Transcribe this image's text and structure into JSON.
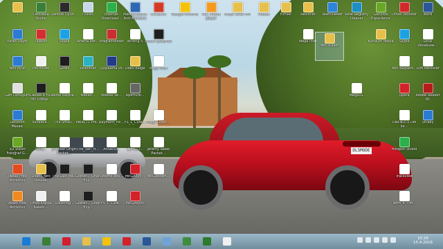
{
  "desktop_icons": [
    {
      "label": "1",
      "icon": "folder-icon",
      "color": "#e7c04b",
      "col": 0,
      "row": 0
    },
    {
      "label": "Camtasia Studio",
      "icon": "camtasia-icon",
      "color": "#3b7f36",
      "col": 1,
      "row": 0
    },
    {
      "label": "Lenovo Oyun...",
      "icon": "gamepad-icon",
      "color": "#2b2b2b",
      "col": 2,
      "row": 0
    },
    {
      "label": "iTunes",
      "icon": "itunes-icon",
      "color": "#c6d7ea",
      "col": 3,
      "row": 0
    },
    {
      "label": "Internet Download...",
      "icon": "download-icon",
      "color": "#2bb04a",
      "col": 4,
      "row": 0
    },
    {
      "label": "Malwarebytes Anti-Malware",
      "icon": "malware-icon",
      "color": "#2e68b3",
      "col": 5,
      "row": 0
    },
    {
      "label": "CCleaner",
      "icon": "ccleaner-icon",
      "color": "#d33b27",
      "col": 6,
      "row": 0
    },
    {
      "label": "Google Chrome",
      "icon": "chrome-icon",
      "color": "#f4c20d",
      "col": 7,
      "row": 0
    },
    {
      "label": "VLC media player",
      "icon": "vlc-icon",
      "color": "#f39a1f",
      "col": 8,
      "row": 0
    },
    {
      "label": "Hepsi 2016 HD",
      "icon": "folder-icon",
      "color": "#e7c04b",
      "col": 9,
      "row": 0
    },
    {
      "label": "Videos",
      "icon": "folder-icon",
      "color": "#e7c04b",
      "col": 10,
      "row": 0
    },
    {
      "label": "Filmler",
      "icon": "folder-icon",
      "color": "#e7c04b",
      "col": 11,
      "row": 0
    },
    {
      "label": "Resimler",
      "icon": "folder-icon",
      "color": "#e7c04b",
      "col": 12,
      "row": 0
    },
    {
      "label": "TeamViewer",
      "icon": "teamviewer-icon",
      "color": "#2e84d6",
      "col": 13,
      "row": 0
    },
    {
      "label": "Wise Registry Cleaner",
      "icon": "wise-icon",
      "color": "#1d8fc2",
      "col": 14,
      "row": 0
    },
    {
      "label": "GeForce Experience",
      "icon": "nvidia-icon",
      "color": "#69a824",
      "col": 15,
      "row": 0
    },
    {
      "label": "Driver Booster",
      "icon": "driver-icon",
      "color": "#d02a2a",
      "col": 16,
      "row": 0
    },
    {
      "label": "Word",
      "icon": "word-icon",
      "color": "#2b5797",
      "col": 17,
      "row": 0
    },
    {
      "label": "Ekran kaydı",
      "icon": "screen-icon",
      "color": "#2b7bd5",
      "col": 0,
      "row": 1
    },
    {
      "label": "Ülkeler",
      "icon": "flag-icon",
      "color": "#d32f2f",
      "col": 1,
      "row": 1
    },
    {
      "label": "Skype",
      "icon": "skype-icon",
      "color": "#1ea1e3",
      "col": 2,
      "row": 1
    },
    {
      "label": "Arama Adr...",
      "icon": "document-icon",
      "color": "#ffffff",
      "col": 3,
      "row": 1
    },
    {
      "label": "ProgramMeter",
      "icon": "pdf-icon",
      "color": "#c92f2f",
      "col": 4,
      "row": 1
    },
    {
      "label": "Writing 5",
      "icon": "document-icon",
      "color": "#ffffff",
      "col": 5,
      "row": 1
    },
    {
      "label": "Ardan Çalışmak",
      "icon": "video-icon",
      "color": "#1e1e1e",
      "col": 6,
      "row": 1
    },
    {
      "label": "Mega Indir",
      "icon": "document-icon",
      "color": "#ffffff",
      "col": 12,
      "row": 1
    },
    {
      "label": "Kurulum dosya",
      "icon": "folder-icon",
      "color": "#e7c04b",
      "col": 15,
      "row": 1
    },
    {
      "label": "Skype",
      "icon": "skype-icon",
      "color": "#1ea1e3",
      "col": 16,
      "row": 1
    },
    {
      "label": "Local Vocabular...",
      "icon": "document-icon",
      "color": "#ffffff",
      "col": 17,
      "row": 1
    },
    {
      "label": "Yeni oyun",
      "icon": "game-icon",
      "color": "#2b7bd5",
      "col": 0,
      "row": 2
    },
    {
      "label": "Pot müzik",
      "icon": "music-icon",
      "color": "#f0f0f0",
      "col": 1,
      "row": 2
    },
    {
      "label": "Görev",
      "icon": "task-icon",
      "color": "#1e1e1e",
      "col": 2,
      "row": 2
    },
    {
      "label": "Eklentiler",
      "icon": "addon-icon",
      "color": "#2bb0c4",
      "col": 3,
      "row": 2
    },
    {
      "label": "Uygulama vs.",
      "icon": "flag-icon",
      "color": "#223a8a",
      "col": 4,
      "row": 2
    },
    {
      "label": "Ödev Belge",
      "icon": "folder-icon",
      "color": "#e7c04b",
      "col": 5,
      "row": 2
    },
    {
      "label": "Mega Indir",
      "icon": "document-icon",
      "color": "#ffffff",
      "col": 6,
      "row": 2
    },
    {
      "label": "Yeni bağlantı...",
      "icon": "document-icon",
      "color": "#ffffff",
      "col": 16,
      "row": 2
    },
    {
      "label": "Tüm teknikler",
      "icon": "document-icon",
      "color": "#ffffff",
      "col": 17,
      "row": 2
    },
    {
      "label": "Geri Dönüşüm",
      "icon": "recycle-bin-icon",
      "color": "#e0e0e0",
      "col": 0,
      "row": 3
    },
    {
      "label": "Cabbie 8 Full HD 1080p...",
      "icon": "video-icon",
      "color": "#1e1e1e",
      "col": 1,
      "row": 3
    },
    {
      "label": "kendi başına...",
      "icon": "document-icon",
      "color": "#ffffff",
      "col": 2,
      "row": 3
    },
    {
      "label": "Mekan...",
      "icon": "document-icon",
      "color": "#ffffff",
      "col": 3,
      "row": 3
    },
    {
      "label": "Meslek ve...",
      "icon": "document-icon",
      "color": "#ffffff",
      "col": 4,
      "row": 3
    },
    {
      "label": "Aperture...",
      "icon": "camera-icon",
      "color": "#666666",
      "col": 5,
      "row": 3
    },
    {
      "label": "MegaDL",
      "icon": "document-icon",
      "color": "#ffffff",
      "col": 14,
      "row": 3
    },
    {
      "label": "Opera",
      "icon": "opera-icon",
      "color": "#d3222a",
      "col": 16,
      "row": 3
    },
    {
      "label": "Adobe Reader DC",
      "icon": "adobe-icon",
      "color": "#b71c1c",
      "col": 17,
      "row": 3
    },
    {
      "label": "Denetim Masası",
      "icon": "control-panel-icon",
      "color": "#2b7bd5",
      "col": 0,
      "row": 4
    },
    {
      "label": "iTunes64...",
      "icon": "document-icon",
      "color": "#ffffff",
      "col": 1,
      "row": 4
    },
    {
      "label": "The Small...",
      "icon": "document-icon",
      "color": "#ffffff",
      "col": 2,
      "row": 4
    },
    {
      "label": "MBRCTL Pro...",
      "icon": "document-icon",
      "color": "#ffffff",
      "col": 3,
      "row": 4
    },
    {
      "label": "payment_fix...",
      "icon": "document-icon",
      "color": "#ffffff",
      "col": 4,
      "row": 4
    },
    {
      "label": "FS_1_Cure...",
      "icon": "document-icon",
      "color": "#ffffff",
      "col": 5,
      "row": 4
    },
    {
      "label": "Mega Down...",
      "icon": "document-icon",
      "color": "#ffffff",
      "col": 6,
      "row": 4
    },
    {
      "label": "ONENOTE DM ile...",
      "icon": "document-icon",
      "color": "#ffffff",
      "col": 16,
      "row": 4
    },
    {
      "label": "Unikey",
      "icon": "keyboard-icon",
      "color": "#2b7bd5",
      "col": 17,
      "row": 4
    },
    {
      "label": "3D Vision Fotoğraf G...",
      "icon": "nvidia-icon",
      "color": "#69a824",
      "col": 0,
      "row": 5
    },
    {
      "label": "daily...",
      "icon": "document-icon",
      "color": "#ffffff",
      "col": 1,
      "row": 5
    },
    {
      "label": "Jeweller Origin Packet...",
      "icon": "document-icon",
      "color": "#ffffff",
      "col": 2,
      "row": 5
    },
    {
      "label": "The_Sell_H...",
      "icon": "document-icon",
      "color": "#ffffff",
      "col": 3,
      "row": 5
    },
    {
      "label": "AtıSecu...",
      "icon": "document-icon",
      "color": "#ffffff",
      "col": 4,
      "row": 5
    },
    {
      "label": "I_am_Ci...",
      "icon": "document-icon",
      "color": "#ffffff",
      "col": 5,
      "row": 5
    },
    {
      "label": "Jeremy Rebel Packet...",
      "icon": "document-icon",
      "color": "#ffffff",
      "col": 6,
      "row": 5
    },
    {
      "label": "Hotspot Shield",
      "icon": "shield-icon",
      "color": "#2bb04a",
      "col": 16,
      "row": 5
    },
    {
      "label": "Tweak Free Antivirus",
      "icon": "antivirus-icon",
      "color": "#e44b1f",
      "col": 0,
      "row": 6
    },
    {
      "label": "Lisans Yeni Dosyası",
      "icon": "folder-icon",
      "color": "#e7c04b",
      "col": 1,
      "row": 6
    },
    {
      "label": "The Last Ma...",
      "icon": "video-icon",
      "color": "#1e1e1e",
      "col": 2,
      "row": 6
    },
    {
      "label": "Göster... Sinan Eyy...",
      "icon": "video-icon",
      "color": "#1e1e1e",
      "col": 3,
      "row": 6
    },
    {
      "label": "Ödeme dev...",
      "icon": "document-icon",
      "color": "#ffffff",
      "col": 4,
      "row": 6
    },
    {
      "label": "MEGAsyn...",
      "icon": "mega-icon",
      "color": "#d3222a",
      "col": 5,
      "row": 6
    },
    {
      "label": "MEGAdown...",
      "icon": "document-icon",
      "color": "#ffffff",
      "col": 6,
      "row": 6
    },
    {
      "label": "Trackview",
      "icon": "document-icon",
      "color": "#ffffff",
      "col": 16,
      "row": 6
    },
    {
      "label": "Avast Free Antivirus",
      "icon": "avast-icon",
      "color": "#f08a1f",
      "col": 0,
      "row": 7
    },
    {
      "label": "Drive Kopya Kalem...",
      "icon": "drive-icon",
      "color": "#f0f0f0",
      "col": 1,
      "row": 7
    },
    {
      "label": "Listening...",
      "icon": "document-icon",
      "color": "#ffffff",
      "col": 2,
      "row": 7
    },
    {
      "label": "Göster... Sinan Eyy...",
      "icon": "video-icon",
      "color": "#1e1e1e",
      "col": 3,
      "row": 7
    },
    {
      "label": "FS_1_Cure...",
      "icon": "document-icon",
      "color": "#ffffff",
      "col": 4,
      "row": 7
    },
    {
      "label": "MEGAsync",
      "icon": "mega-icon",
      "color": "#d3222a",
      "col": 5,
      "row": 7
    },
    {
      "label": "Term_4_Tim...",
      "icon": "document-icon",
      "color": "#ffffff",
      "col": 16,
      "row": 7
    }
  ],
  "selected_icon": {
    "label": "Yeni klasör",
    "icon": "folder-icon",
    "color": "#e7c04b"
  },
  "taskbar": {
    "apps": [
      {
        "name": "ie-icon",
        "color": "#1b7bd6"
      },
      {
        "name": "camtasia-icon",
        "color": "#3b7f36"
      },
      {
        "name": "record-icon",
        "color": "#d11f2f"
      },
      {
        "name": "folder-icon",
        "color": "#e7c04b"
      },
      {
        "name": "chrome-icon",
        "color": "#f4c20d"
      },
      {
        "name": "opera-icon",
        "color": "#d3222a"
      },
      {
        "name": "word-icon",
        "color": "#2b5797"
      },
      {
        "name": "paint-icon",
        "color": "#6fa2d8"
      },
      {
        "name": "globe-icon",
        "color": "#3d8c3f"
      },
      {
        "name": "camtasia-rec-icon",
        "color": "#2d7a2d"
      },
      {
        "name": "camtasia-editor-icon",
        "color": "#f0f0f0"
      }
    ],
    "clock": {
      "time": "15:26",
      "date": "15.4.2016"
    }
  }
}
